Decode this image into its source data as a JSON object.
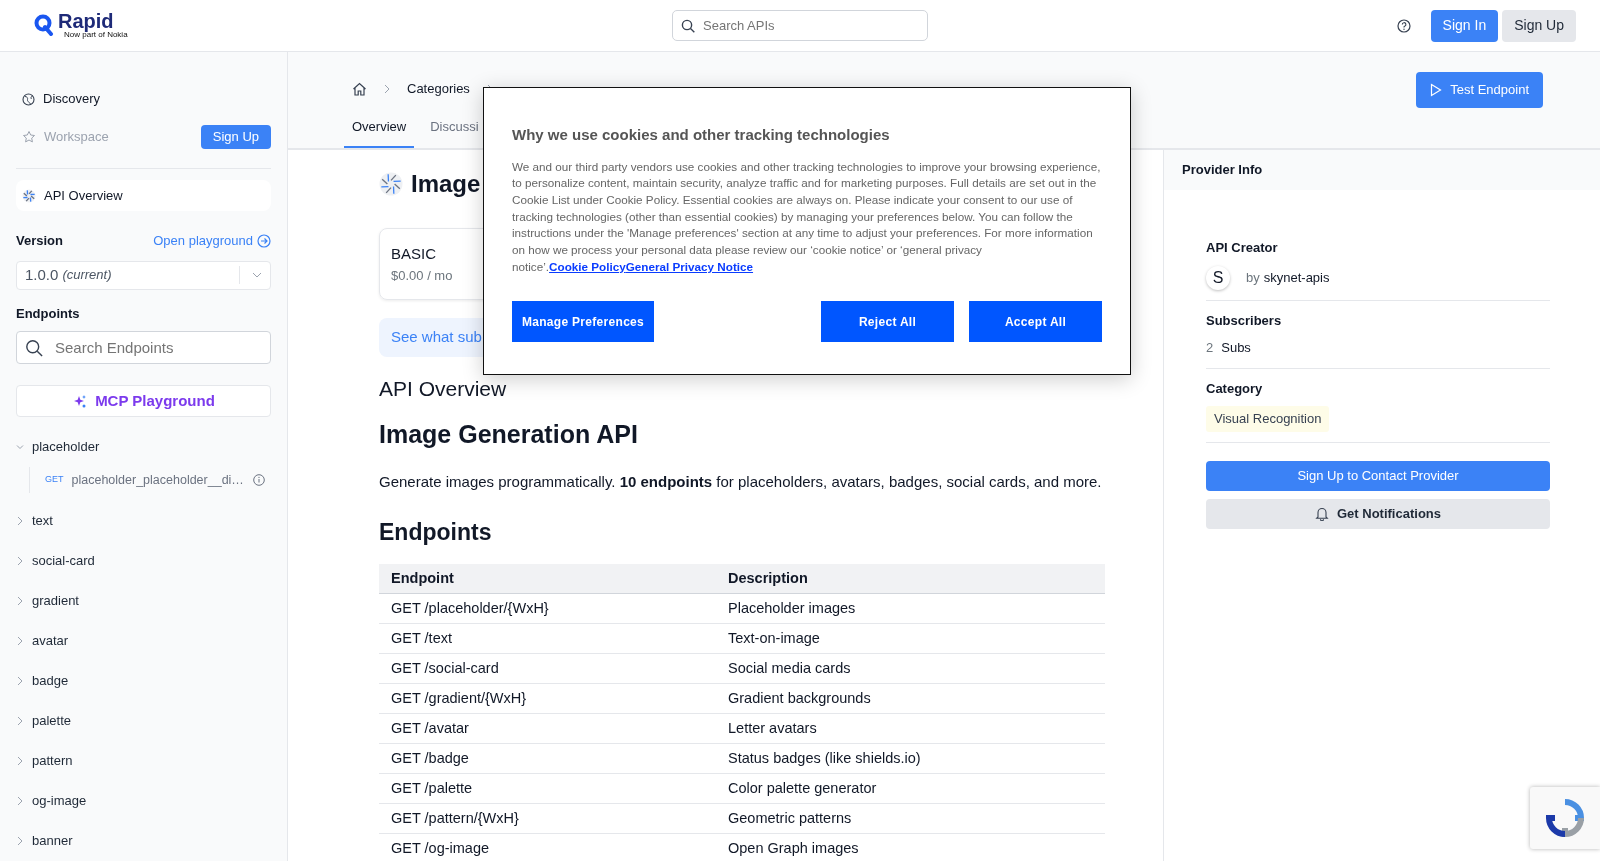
{
  "header": {
    "logo": {
      "name": "Rapid",
      "tagline": "Now part of Nokia"
    },
    "search": {
      "placeholder": "Search APIs"
    },
    "buttons": [
      {
        "label": "Sign In",
        "kind": "primary"
      },
      {
        "label": "Sign Up",
        "kind": "secondary"
      }
    ]
  },
  "sidebar": {
    "nav": [
      {
        "label": "Discovery",
        "disabled": false
      },
      {
        "label": "Workspace",
        "disabled": true
      }
    ],
    "signup_button": "Sign Up",
    "overview_item": {
      "label": "API Overview",
      "selected": true
    },
    "version": {
      "label": "Version",
      "link": "Open playground",
      "value": "1.0.0",
      "note": "(current)"
    },
    "endpoints": {
      "label": "Endpoints",
      "search_placeholder": "Search Endpoints",
      "mcp_button": "MCP Playground",
      "groups": [
        {
          "label": "placeholder",
          "expanded": true,
          "children": [
            {
              "method": "GET",
              "label": "placeholder_placeholder__di…"
            }
          ]
        },
        {
          "label": "text",
          "expanded": false
        },
        {
          "label": "social-card",
          "expanded": false
        },
        {
          "label": "gradient",
          "expanded": false
        },
        {
          "label": "avatar",
          "expanded": false
        },
        {
          "label": "badge",
          "expanded": false
        },
        {
          "label": "palette",
          "expanded": false
        },
        {
          "label": "pattern",
          "expanded": false
        },
        {
          "label": "og-image",
          "expanded": false
        },
        {
          "label": "banner",
          "expanded": false
        }
      ]
    }
  },
  "main": {
    "breadcrumb": [
      "Categories"
    ],
    "tabs": [
      {
        "label": "Overview",
        "selected": true
      },
      {
        "label": "Discussi",
        "selected": false
      }
    ],
    "test_button": "Test Endpoint",
    "title": "Image",
    "plan": {
      "name": "BASIC",
      "price": "$0.00 / mo"
    },
    "banner": "See what sub",
    "section_label": "API Overview",
    "heading": "Image Generation API",
    "intro": "Generate images programmatically. **10 endpoints** for placeholders, avatars, badges, social cards, and more.",
    "endpoints_heading": "Endpoints",
    "table": {
      "columns": [
        "Endpoint",
        "Description"
      ],
      "rows": [
        [
          "GET /placeholder/{WxH}",
          "Placeholder images"
        ],
        [
          "GET /text",
          "Text-on-image"
        ],
        [
          "GET /social-card",
          "Social media cards"
        ],
        [
          "GET /gradient/{WxH}",
          "Gradient backgrounds"
        ],
        [
          "GET /avatar",
          "Letter avatars"
        ],
        [
          "GET /badge",
          "Status badges (like shields.io)"
        ],
        [
          "GET /palette",
          "Color palette generator"
        ],
        [
          "GET /pattern/{WxH}",
          "Geometric patterns"
        ],
        [
          "GET /og-image",
          "Open Graph images"
        ]
      ]
    }
  },
  "provider": {
    "title": "Provider Info",
    "creator": {
      "label": "API Creator",
      "avatar": "S",
      "by": "by",
      "name": "skynet-apis"
    },
    "subscribers": {
      "label": "Subscribers",
      "count": "2",
      "unit": "Subs"
    },
    "category": {
      "label": "Category",
      "tag": "Visual Recognition"
    },
    "buttons": [
      {
        "label": "Sign Up to Contact Provider",
        "kind": "primary"
      },
      {
        "label": "Get Notifications",
        "kind": "secondary"
      }
    ]
  },
  "cookie_dialog": {
    "title": "Why we use cookies and other tracking technologies",
    "body": "We and our third party vendors use cookies and other tracking technologies to improve your browsing experience, to personalize content, maintain security, analyze traffic and for marketing purposes. Full details are set out in the Cookie List under Cookie Policy. Essential cookies are always on. Please indicate your consent to our use of tracking technologies (other than essential cookies) by managing your preferences below. You can follow the instructions under the 'Manage preferences' section at any time to adjust your preferences. For more information on how we process your personal data please review our ‘cookie notice’ or ‘general privacy notice’.",
    "links": [
      "Cookie Policy",
      "General Privacy Notice"
    ],
    "buttons": [
      {
        "label": "Manage Preferences"
      },
      {
        "label": "Reject All"
      },
      {
        "label": "Accept All"
      }
    ]
  }
}
